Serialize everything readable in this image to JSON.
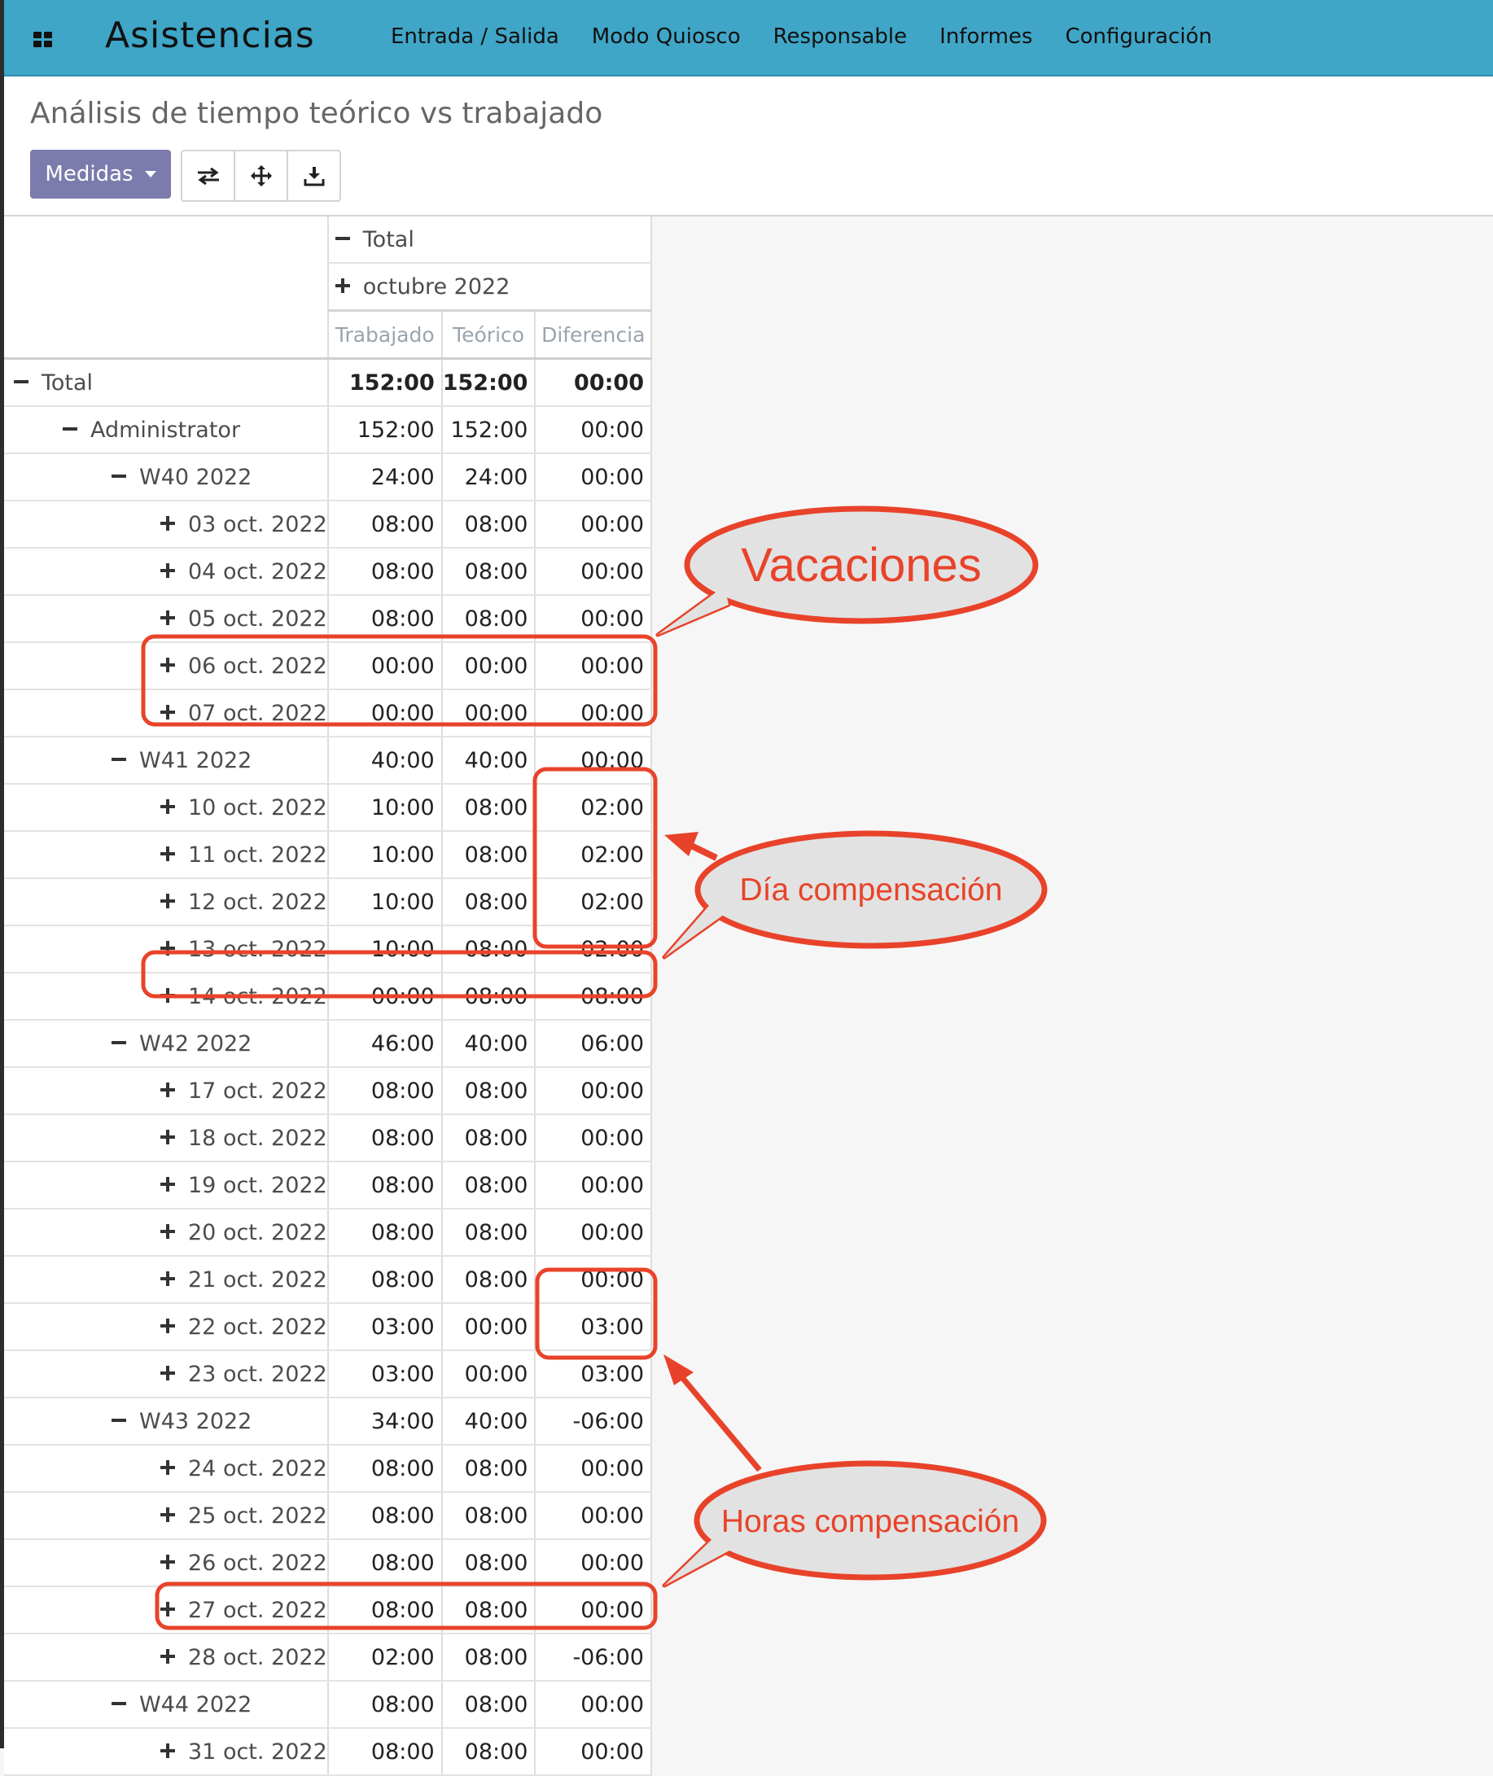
{
  "app": {
    "title": "Asistencias",
    "menu": [
      "Entrada / Salida",
      "Modo Quiosco",
      "Responsable",
      "Informes",
      "Configuración"
    ]
  },
  "page": {
    "breadcrumb": "Análisis de tiempo teórico vs trabajado",
    "measures_button": "Medidas"
  },
  "toolbar_icons": [
    "flip-axis-icon",
    "expand-all-icon",
    "download-icon"
  ],
  "pivot": {
    "col_total": "Total",
    "col_group": "octubre 2022",
    "measures": [
      "Trabajado",
      "Teórico",
      "Diferencia"
    ],
    "rows": [
      {
        "label": "Total",
        "level": 0,
        "toggle": "minus",
        "values": [
          "152:00",
          "152:00",
          "00:00"
        ],
        "bold": true
      },
      {
        "label": "Administrator",
        "level": 1,
        "toggle": "minus",
        "values": [
          "152:00",
          "152:00",
          "00:00"
        ]
      },
      {
        "label": "W40 2022",
        "level": 2,
        "toggle": "minus",
        "values": [
          "24:00",
          "24:00",
          "00:00"
        ]
      },
      {
        "label": "03 oct. 2022",
        "level": 3,
        "toggle": "plus",
        "values": [
          "08:00",
          "08:00",
          "00:00"
        ]
      },
      {
        "label": "04 oct. 2022",
        "level": 3,
        "toggle": "plus",
        "values": [
          "08:00",
          "08:00",
          "00:00"
        ]
      },
      {
        "label": "05 oct. 2022",
        "level": 3,
        "toggle": "plus",
        "values": [
          "08:00",
          "08:00",
          "00:00"
        ]
      },
      {
        "label": "06 oct. 2022",
        "level": 3,
        "toggle": "plus",
        "values": [
          "00:00",
          "00:00",
          "00:00"
        ]
      },
      {
        "label": "07 oct. 2022",
        "level": 3,
        "toggle": "plus",
        "values": [
          "00:00",
          "00:00",
          "00:00"
        ]
      },
      {
        "label": "W41 2022",
        "level": 2,
        "toggle": "minus",
        "values": [
          "40:00",
          "40:00",
          "00:00"
        ]
      },
      {
        "label": "10 oct. 2022",
        "level": 3,
        "toggle": "plus",
        "values": [
          "10:00",
          "08:00",
          "02:00"
        ]
      },
      {
        "label": "11 oct. 2022",
        "level": 3,
        "toggle": "plus",
        "values": [
          "10:00",
          "08:00",
          "02:00"
        ]
      },
      {
        "label": "12 oct. 2022",
        "level": 3,
        "toggle": "plus",
        "values": [
          "10:00",
          "08:00",
          "02:00"
        ]
      },
      {
        "label": "13 oct. 2022",
        "level": 3,
        "toggle": "plus",
        "values": [
          "10:00",
          "08:00",
          "02:00"
        ]
      },
      {
        "label": "14 oct. 2022",
        "level": 3,
        "toggle": "plus",
        "values": [
          "00:00",
          "08:00",
          "-08:00"
        ]
      },
      {
        "label": "W42 2022",
        "level": 2,
        "toggle": "minus",
        "values": [
          "46:00",
          "40:00",
          "06:00"
        ]
      },
      {
        "label": "17 oct. 2022",
        "level": 3,
        "toggle": "plus",
        "values": [
          "08:00",
          "08:00",
          "00:00"
        ]
      },
      {
        "label": "18 oct. 2022",
        "level": 3,
        "toggle": "plus",
        "values": [
          "08:00",
          "08:00",
          "00:00"
        ]
      },
      {
        "label": "19 oct. 2022",
        "level": 3,
        "toggle": "plus",
        "values": [
          "08:00",
          "08:00",
          "00:00"
        ]
      },
      {
        "label": "20 oct. 2022",
        "level": 3,
        "toggle": "plus",
        "values": [
          "08:00",
          "08:00",
          "00:00"
        ]
      },
      {
        "label": "21 oct. 2022",
        "level": 3,
        "toggle": "plus",
        "values": [
          "08:00",
          "08:00",
          "00:00"
        ]
      },
      {
        "label": "22 oct. 2022",
        "level": 3,
        "toggle": "plus",
        "values": [
          "03:00",
          "00:00",
          "03:00"
        ]
      },
      {
        "label": "23 oct. 2022",
        "level": 3,
        "toggle": "plus",
        "values": [
          "03:00",
          "00:00",
          "03:00"
        ]
      },
      {
        "label": "W43 2022",
        "level": 2,
        "toggle": "minus",
        "values": [
          "34:00",
          "40:00",
          "-06:00"
        ]
      },
      {
        "label": "24 oct. 2022",
        "level": 3,
        "toggle": "plus",
        "values": [
          "08:00",
          "08:00",
          "00:00"
        ]
      },
      {
        "label": "25 oct. 2022",
        "level": 3,
        "toggle": "plus",
        "values": [
          "08:00",
          "08:00",
          "00:00"
        ]
      },
      {
        "label": "26 oct. 2022",
        "level": 3,
        "toggle": "plus",
        "values": [
          "08:00",
          "08:00",
          "00:00"
        ]
      },
      {
        "label": "27 oct. 2022",
        "level": 3,
        "toggle": "plus",
        "values": [
          "08:00",
          "08:00",
          "00:00"
        ]
      },
      {
        "label": "28 oct. 2022",
        "level": 3,
        "toggle": "plus",
        "values": [
          "02:00",
          "08:00",
          "-06:00"
        ]
      },
      {
        "label": "W44 2022",
        "level": 2,
        "toggle": "minus",
        "values": [
          "08:00",
          "08:00",
          "00:00"
        ]
      },
      {
        "label": "31 oct. 2022",
        "level": 3,
        "toggle": "plus",
        "values": [
          "08:00",
          "08:00",
          "00:00"
        ]
      }
    ]
  },
  "annotations": {
    "vacaciones": "Vacaciones",
    "dia_compensacion": "Día compensación",
    "horas_compensacion": "Horas compensación",
    "color": "#e8432a",
    "bubble_fill": "#e2e2e2"
  }
}
